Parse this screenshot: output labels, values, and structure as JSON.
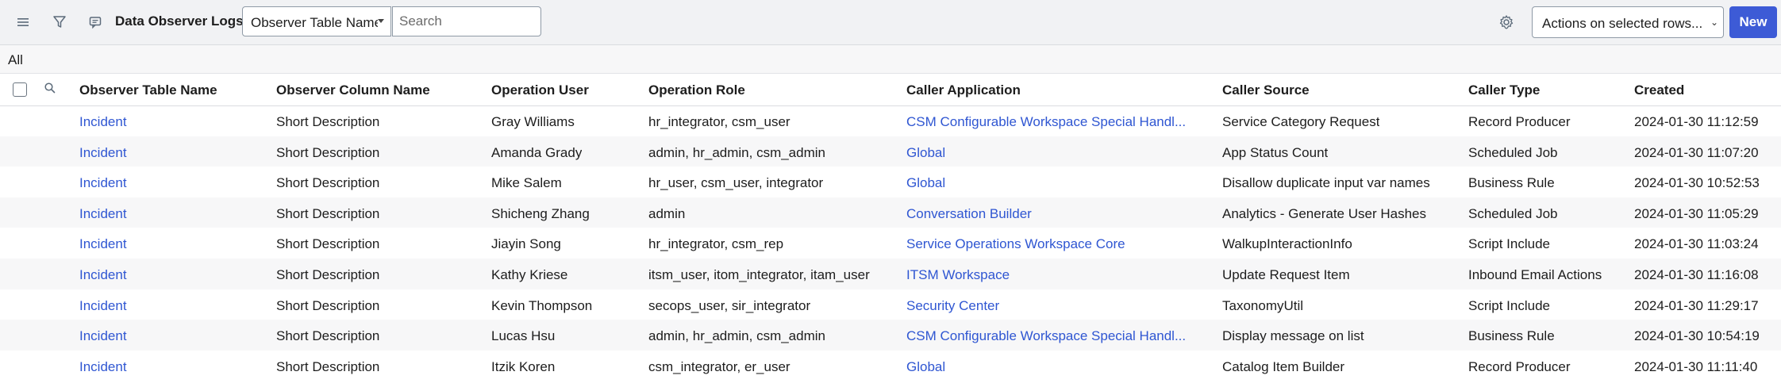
{
  "toolbar": {
    "title": "Data Observer Logs",
    "field_select_value": "Observer Table Name",
    "search_placeholder": "Search",
    "actions_label": "Actions on selected rows...",
    "new_label": "New",
    "icons": [
      "hamburger-menu-icon",
      "filter-icon",
      "chat-bubble-icon",
      "gear-icon"
    ]
  },
  "breadcrumb": {
    "label": "All"
  },
  "columns": [
    "Observer Table Name",
    "Observer Column Name",
    "Operation User",
    "Operation Role",
    "Caller Application",
    "Caller Source",
    "Caller Type",
    "Created"
  ],
  "rows": [
    {
      "table": "Incident",
      "column": "Short Description",
      "user": "Gray Williams",
      "role": "hr_integrator, csm_user",
      "app": "CSM Configurable Workspace Special Handl...",
      "source": "Service Category Request",
      "type": "Record Producer",
      "created": "2024-01-30 11:12:59"
    },
    {
      "table": "Incident",
      "column": "Short Description",
      "user": "Amanda Grady",
      "role": "admin, hr_admin, csm_admin",
      "app": "Global",
      "source": "App Status Count",
      "type": "Scheduled Job",
      "created": "2024-01-30 11:07:20"
    },
    {
      "table": "Incident",
      "column": "Short Description",
      "user": "Mike Salem",
      "role": "hr_user, csm_user, integrator",
      "app": "Global",
      "source": "Disallow duplicate input var names",
      "type": "Business Rule",
      "created": "2024-01-30 10:52:53"
    },
    {
      "table": "Incident",
      "column": "Short Description",
      "user": "Shicheng Zhang",
      "role": "admin",
      "app": "Conversation Builder",
      "source": "Analytics - Generate User Hashes",
      "type": "Scheduled Job",
      "created": "2024-01-30 11:05:29"
    },
    {
      "table": "Incident",
      "column": "Short Description",
      "user": "Jiayin Song",
      "role": "hr_integrator, csm_rep",
      "app": "Service Operations Workspace Core",
      "source": "WalkupInteractionInfo",
      "type": "Script Include",
      "created": "2024-01-30 11:03:24"
    },
    {
      "table": "Incident",
      "column": "Short Description",
      "user": "Kathy Kriese",
      "role": "itsm_user, itom_integrator, itam_user",
      "app": "ITSM Workspace",
      "source": "Update Request Item",
      "type": "Inbound Email Actions",
      "created": "2024-01-30 11:16:08"
    },
    {
      "table": "Incident",
      "column": "Short Description",
      "user": "Kevin Thompson",
      "role": "secops_user, sir_integrator",
      "app": "Security Center",
      "source": "TaxonomyUtil",
      "type": "Script Include",
      "created": "2024-01-30 11:29:17"
    },
    {
      "table": "Incident",
      "column": "Short Description",
      "user": "Lucas Hsu",
      "role": "admin, hr_admin, csm_admin",
      "app": "CSM Configurable Workspace Special Handl...",
      "source": "Display message on list",
      "type": "Business Rule",
      "created": "2024-01-30 10:54:19"
    },
    {
      "table": "Incident",
      "column": "Short Description",
      "user": "Itzik Koren",
      "role": "csm_integrator, er_user",
      "app": "Global",
      "source": "Catalog Item Builder",
      "type": "Record Producer",
      "created": "2024-01-30 11:11:40"
    }
  ],
  "colors": {
    "link": "#2f56d2",
    "primary_button": "#3d5bd6",
    "toolbar_bg": "#f1f2f4"
  }
}
